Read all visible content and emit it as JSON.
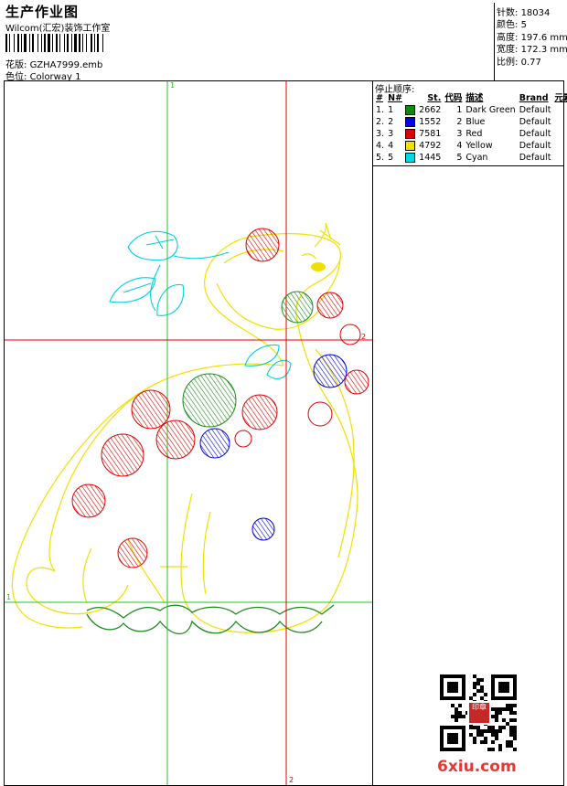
{
  "header": {
    "title": "生产作业图",
    "company": "Wilcom(汇宏)装饰工作室",
    "design_label": "花版:",
    "design_file": "GZHA7999.emb",
    "colorway_label": "色位:",
    "colorway": "Colorway 1"
  },
  "stats": {
    "stitches_label": "针数:",
    "stitches": "18034",
    "colors_label": "颜色:",
    "colors": "5",
    "height_label": "高度:",
    "height": "197.6 mm",
    "width_label": "宽度:",
    "width": "172.3 mm",
    "scale_label": "比例:",
    "scale": "0.77"
  },
  "stop_sequence": {
    "title": "停止顺序:",
    "headers": [
      "#",
      "N#",
      "St.",
      "代码",
      "描述",
      "Brand",
      "元素"
    ],
    "rows": [
      {
        "num": "1.",
        "n": "1",
        "st": "2662",
        "code": "1",
        "desc": "Dark Green",
        "brand": "Default",
        "color": "#0a8a0a"
      },
      {
        "num": "2.",
        "n": "2",
        "st": "1552",
        "code": "2",
        "desc": "Blue",
        "brand": "Default",
        "color": "#0000ee"
      },
      {
        "num": "3.",
        "n": "3",
        "st": "7581",
        "code": "3",
        "desc": "Red",
        "brand": "Default",
        "color": "#dd0000"
      },
      {
        "num": "4.",
        "n": "4",
        "st": "4792",
        "code": "4",
        "desc": "Yellow",
        "brand": "Default",
        "color": "#f0e000"
      },
      {
        "num": "5.",
        "n": "5",
        "st": "1445",
        "code": "5",
        "desc": "Cyan",
        "brand": "Default",
        "color": "#00d8e8"
      }
    ]
  },
  "guides": {
    "green_label_top": "1",
    "green_label_left": "1",
    "red_label_right": "2",
    "red_label_bottom": "2"
  },
  "watermark": {
    "site": "6xiu.com",
    "seal_text": "印章"
  },
  "colors": {
    "green": "#1ec81e",
    "red": "#e00000",
    "yellow": "#f0e000",
    "cyan": "#00d0e0",
    "blue": "#0000dd",
    "dark_green": "#1a8a1a"
  }
}
